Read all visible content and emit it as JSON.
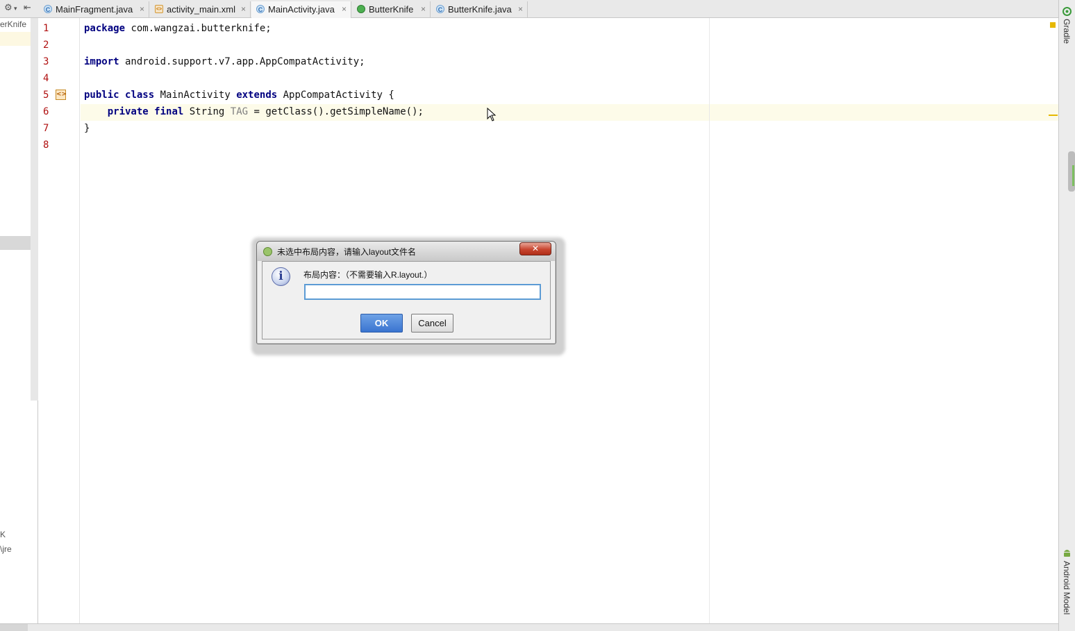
{
  "tabs": [
    {
      "icon": "class-icon",
      "badge": "C",
      "label": "MainFragment.java",
      "active": false
    },
    {
      "icon": "xml-layout-icon",
      "badge": "<>",
      "label": "activity_main.xml",
      "active": false
    },
    {
      "icon": "class-icon",
      "badge": "C",
      "label": "MainActivity.java",
      "active": true
    },
    {
      "icon": "butterknife-icon",
      "badge": "",
      "label": "ButterKnife",
      "active": false
    },
    {
      "icon": "class-g-icon",
      "badge": "C",
      "label": "ButterKnife.java",
      "active": false
    }
  ],
  "tab_close_glyph": "×",
  "left_panel": {
    "project_label": "erKnife",
    "bottom_text_1": "K",
    "bottom_text_2": "\\jre"
  },
  "line_numbers": [
    "1",
    "2",
    "3",
    "4",
    "5",
    "6",
    "7",
    "8"
  ],
  "code": {
    "line1_kw": "package",
    "line1_rest": " com.wangzai.butterknife;",
    "line3_kw": "import",
    "line3_rest": " android.support.v7.app.AppCompatActivity;",
    "line5_kw1": "public",
    "line5_kw2": "class",
    "line5_name": " MainActivity ",
    "line5_kw3": "extends",
    "line5_rest": " AppCompatActivity {",
    "line6_indent": "    ",
    "line6_kw1": "private",
    "line6_kw2": "final",
    "line6_type": " String ",
    "line6_const": "TAG",
    "line6_rest": " = getClass().getSimpleName();",
    "line7": "}"
  },
  "right_strip": {
    "gradle_label": "Gradle",
    "android_model_label": "Android Model"
  },
  "dialog": {
    "title": "未选中布局内容，请输入layout文件名",
    "close_glyph": "✕",
    "info_glyph": "i",
    "message": "布局内容：（不需要输入R.layout.）",
    "input_value": "",
    "ok_label": "OK",
    "cancel_label": "Cancel"
  },
  "colors": {
    "keyword": "#000080",
    "constant": "#808080",
    "line_number": "#b01010",
    "current_line": "#fdfbe9",
    "ok_button": "#3a74d0"
  }
}
